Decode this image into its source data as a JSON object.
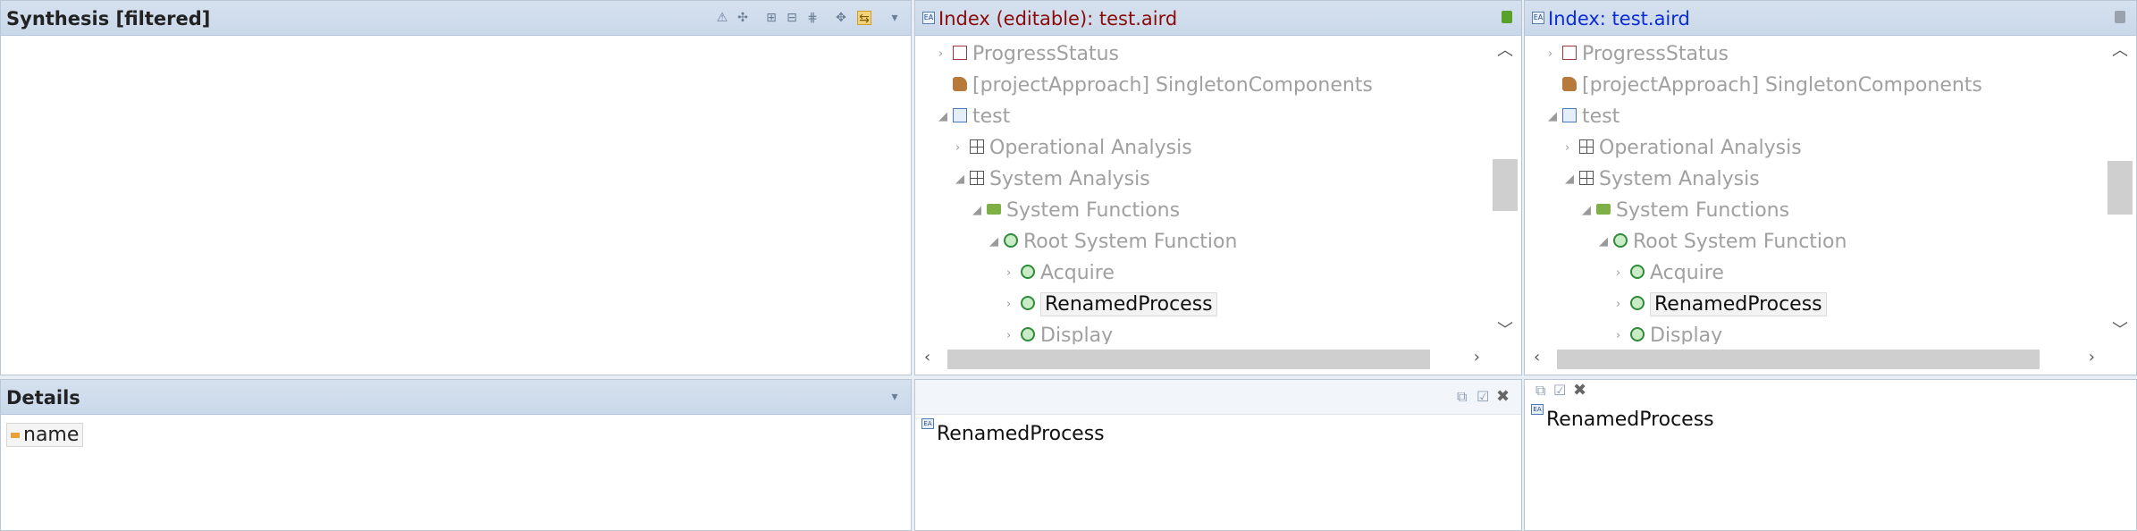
{
  "synthesis": {
    "title": "Synthesis [filtered]"
  },
  "index_editable": {
    "title": "Index (editable): test.aird"
  },
  "index_readonly": {
    "title": "Index: test.aird"
  },
  "tree": [
    {
      "label": "ProgressStatus",
      "icon": "table-icon"
    },
    {
      "label": "[projectApproach] SingletonComponents",
      "icon": "approach-icon"
    },
    {
      "label": "test",
      "icon": "project-icon"
    },
    {
      "label": "Operational Analysis",
      "icon": "layer-icon"
    },
    {
      "label": "System Analysis",
      "icon": "layer-icon"
    },
    {
      "label": "System Functions",
      "icon": "folder-icon"
    },
    {
      "label": "Root System Function",
      "icon": "function-icon"
    },
    {
      "label": "Acquire",
      "icon": "function-icon"
    },
    {
      "label": "RenamedProcess",
      "icon": "function-icon",
      "selected": true
    },
    {
      "label": "Display",
      "icon": "function-icon"
    }
  ],
  "details": {
    "title": "Details",
    "field_name": "name"
  },
  "property_center": {
    "value": "RenamedProcess"
  },
  "property_right": {
    "value": "RenamedProcess"
  }
}
